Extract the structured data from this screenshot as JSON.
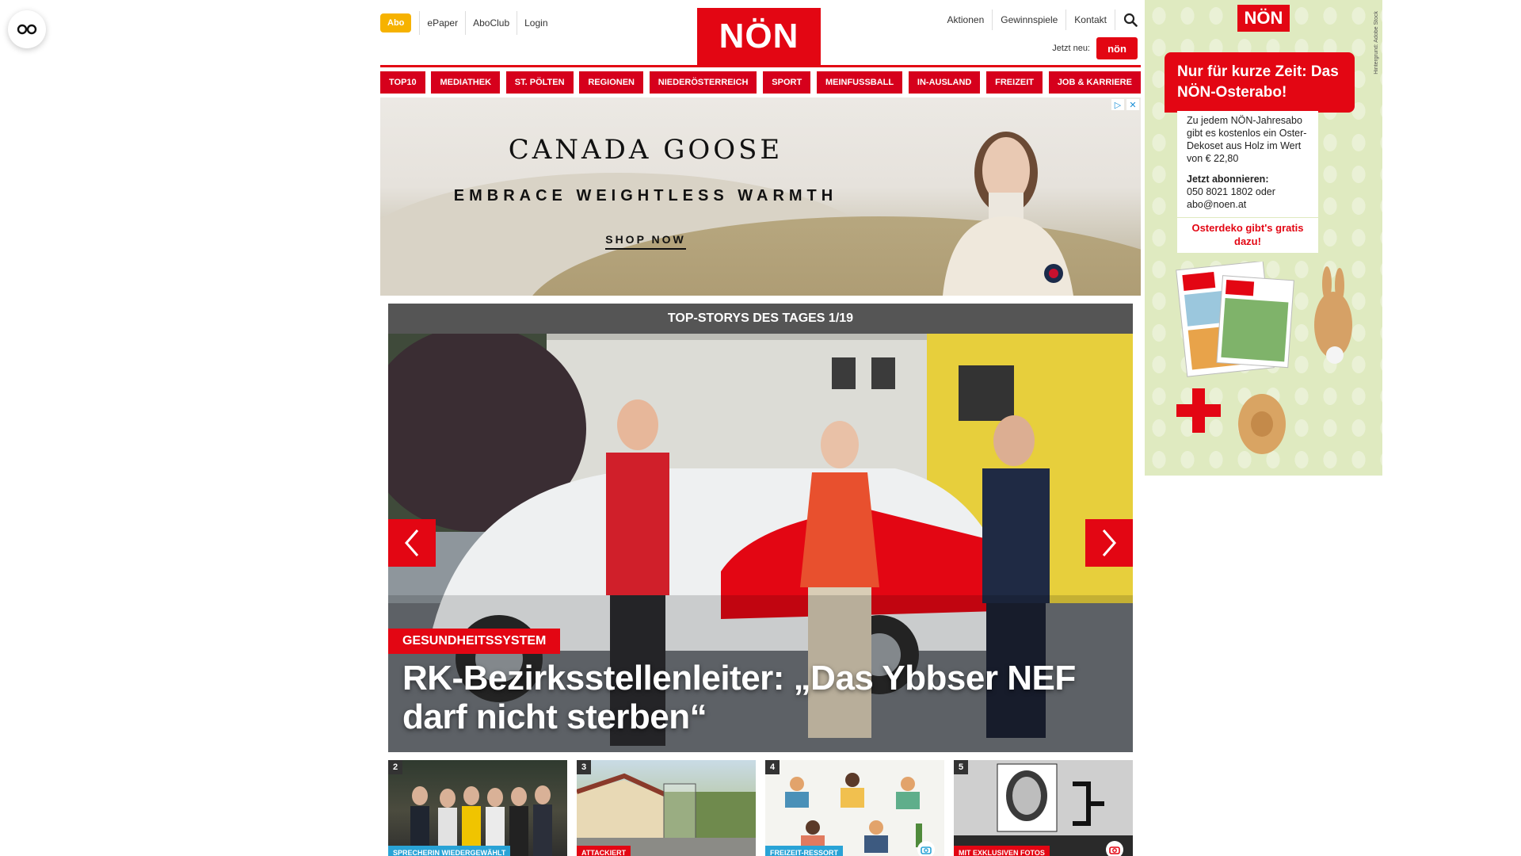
{
  "accessibility": {
    "icon": "glasses-icon"
  },
  "header": {
    "abo": "Abo",
    "links_left": [
      "ePaper",
      "AboClub",
      "Login"
    ],
    "logo": "NÖN",
    "links_right": [
      "Aktionen",
      "Gewinnspiele",
      "Kontakt"
    ],
    "jetzt_neu": "Jetzt neu:",
    "jetzt_logo": "nön"
  },
  "nav": [
    "TOP10",
    "MEDIATHEK",
    "ST. PÖLTEN",
    "REGIONEN",
    "NIEDERÖSTERREICH",
    "SPORT",
    "MEINFUSSBALL",
    "IN-AUSLAND",
    "FREIZEIT",
    "JOB & KARRIERE"
  ],
  "ad": {
    "brand": "CANADA GOOSE",
    "tagline": "EMBRACE WEIGHTLESS WARMTH",
    "cta": "SHOP NOW"
  },
  "stories": {
    "heading": "TOP-STORYS DES TAGES 1/19",
    "hero": {
      "category": "GESUNDHEITSSYSTEM",
      "title": "RK-Bezirksstellenleiter: „Das Ybbser NEF darf nicht sterben“"
    },
    "thumbs": [
      {
        "num": "2",
        "category": "SPRECHERIN WIEDERGEWÄHLT",
        "color": "#29a3d6"
      },
      {
        "num": "3",
        "category": "ATTACKIERT",
        "color": "#e30613"
      },
      {
        "num": "4",
        "category": "FREIZEIT-RESSORT",
        "color": "#29a3d6"
      },
      {
        "num": "5",
        "category": "MIT EXKLUSIVEN FOTOS",
        "color": "#e30613"
      }
    ]
  },
  "sidebar_ad": {
    "logo": "NÖN",
    "promo": "Nur für kurze Zeit: Das NÖN-Osterabo!",
    "text": "Zu jedem NÖN-Jahresabo gibt es kostenlos ein Oster-Dekoset aus Holz im Wert von € 22,80",
    "cta_title": "Jetzt abonnieren:",
    "cta_text": "050 8021 1802 oder abo@noen.at",
    "deko": "Osterdeko gibt's gratis dazu!"
  },
  "colors": {
    "brand_red": "#e30613",
    "abo_yellow": "#f6b200"
  }
}
